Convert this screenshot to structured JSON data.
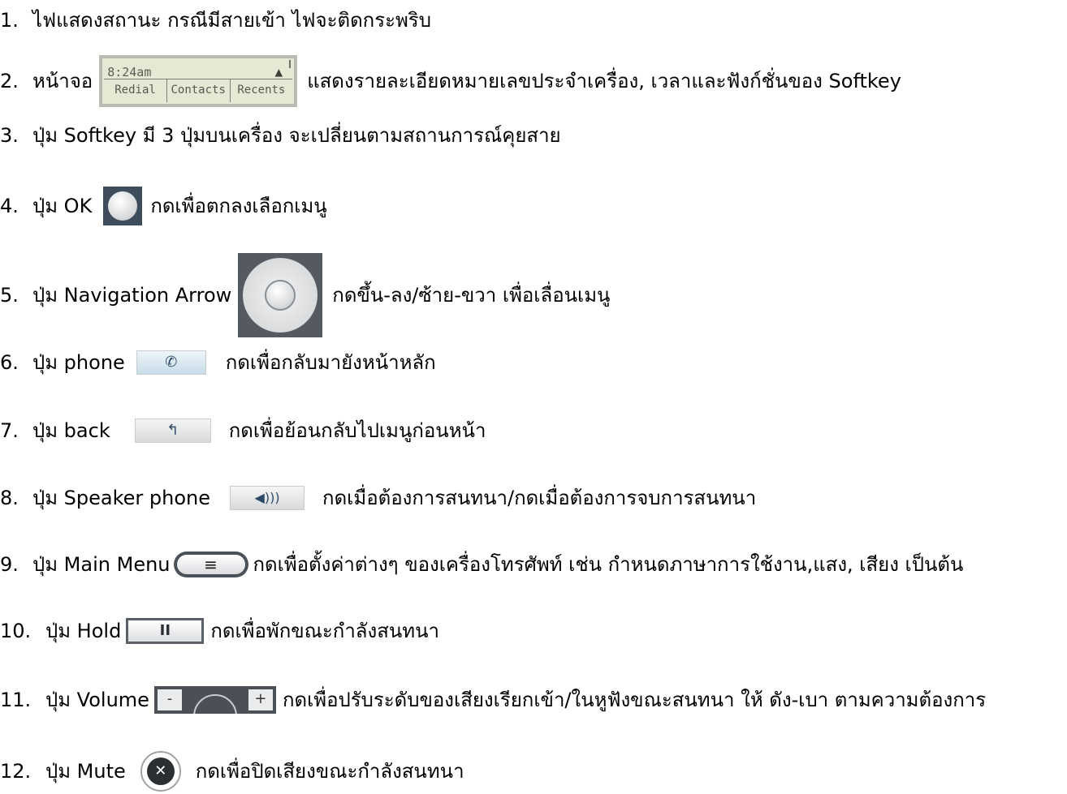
{
  "items": [
    {
      "num": "1.",
      "text": "ไฟแสดงสถานะ กรณีมีสายเข้า ไฟจะติดกระพริบ"
    },
    {
      "num": "2.",
      "pre": "หน้าจอ",
      "text": "แสดงรายละเอียดหมายเลขประจำเครื่อง, เวลาและฟังก์ชั่นของ Softkey",
      "lcd": {
        "time": "8:24am",
        "softkeys": [
          "Redial",
          "Contacts",
          "Recents"
        ]
      }
    },
    {
      "num": "3.",
      "text": "ปุ่ม Softkey มี 3 ปุ่มบนเครื่อง จะเปลี่ยนตามสถานการณ์คุยสาย"
    },
    {
      "num": "4.",
      "pre": "ปุ่ม OK",
      "text": "กดเพื่อตกลงเลือกเมนู"
    },
    {
      "num": "5.",
      "pre": "ปุ่ม Navigation Arrow",
      "text": "กดขึ้น-ลง/ซ้าย-ขวา เพื่อเลื่อนเมนู"
    },
    {
      "num": "6.",
      "pre": "ปุ่ม phone",
      "text": "กดเพื่อกลับมายังหน้าหลัก"
    },
    {
      "num": "7.",
      "pre": "ปุ่ม back",
      "text": "กดเพื่อย้อนกลับไปเมนูก่อนหน้า"
    },
    {
      "num": "8.",
      "pre": "ปุ่ม Speaker phone",
      "text": "กดเมื่อต้องการสนทนา/กดเมื่อต้องการจบการสนทนา"
    },
    {
      "num": "9.",
      "pre": "ปุ่ม Main Menu",
      "text": "กดเพื่อตั้งค่าต่างๆ ของเครื่องโทรศัพท์ เช่น กำหนดภาษาการใช้งาน,แสง, เสียง เป็นต้น"
    },
    {
      "num": "10.",
      "pre": "ปุ่ม Hold",
      "text": "กดเพื่อพักขณะกำลังสนทนา"
    },
    {
      "num": "11.",
      "pre": "ปุ่ม Volume",
      "text": "กดเพื่อปรับระดับของเสียงเรียกเข้า/ในหูฟังขณะสนทนา ให้ ดัง-เบา ตามความต้องการ"
    },
    {
      "num": "12.",
      "pre": "ปุ่ม Mute",
      "text": "กดเพื่อปิดเสียงขณะกำลังสนทนา"
    }
  ],
  "icons": {
    "ok": "ok-button-icon",
    "nav": "navigation-arrow-icon",
    "phone": "phone-handset-icon",
    "back": "back-arrow-icon",
    "speaker": "speaker-icon",
    "menu": "menu-lines-icon",
    "hold": "pause-icon",
    "volume": "volume-rocker-icon",
    "mute": "mic-muted-icon"
  }
}
